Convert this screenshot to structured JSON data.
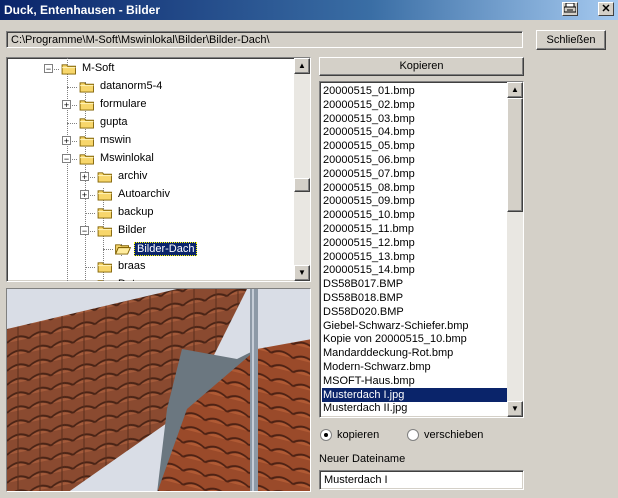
{
  "window": {
    "title": "Duck, Entenhausen - Bilder",
    "print_icon": "printer-icon",
    "close_glyph": "✕"
  },
  "path": "C:\\Programme\\M-Soft\\Mswinlokal\\Bilder\\Bilder-Dach\\",
  "buttons": {
    "close_label": "Schließen",
    "copy_label": "Kopieren"
  },
  "tree": {
    "items": [
      {
        "label": "M-Soft",
        "expander": "−"
      },
      {
        "label": "datanorm5-4",
        "expander": ""
      },
      {
        "label": "formulare",
        "expander": "+"
      },
      {
        "label": "gupta",
        "expander": ""
      },
      {
        "label": "mswin",
        "expander": "+"
      },
      {
        "label": "Mswinlokal",
        "expander": "−"
      },
      {
        "label": "archiv",
        "expander": "+"
      },
      {
        "label": "Autoarchiv",
        "expander": "+"
      },
      {
        "label": "backup",
        "expander": ""
      },
      {
        "label": "Bilder",
        "expander": "−"
      },
      {
        "label": "Bilder-Dach",
        "expander": ""
      },
      {
        "label": "braas",
        "expander": ""
      },
      {
        "label": "Data",
        "expander": ""
      }
    ]
  },
  "files": {
    "items": [
      "20000515_01.bmp",
      "20000515_02.bmp",
      "20000515_03.bmp",
      "20000515_04.bmp",
      "20000515_05.bmp",
      "20000515_06.bmp",
      "20000515_07.bmp",
      "20000515_08.bmp",
      "20000515_09.bmp",
      "20000515_10.bmp",
      "20000515_11.bmp",
      "20000515_12.bmp",
      "20000515_13.bmp",
      "20000515_14.bmp",
      "DS58B017.BMP",
      "DS58B018.BMP",
      "DS58D020.BMP",
      "Giebel-Schwarz-Schiefer.bmp",
      "Kopie von 20000515_10.bmp",
      "Mandarddeckung-Rot.bmp",
      "Modern-Schwarz.bmp",
      "MSOFT-Haus.bmp",
      "Musterdach I.jpg",
      "Musterdach II.jpg"
    ],
    "selected": "Musterdach I.jpg"
  },
  "options": {
    "copy": "kopieren",
    "move": "verschieben",
    "selected": "copy"
  },
  "new_name": {
    "label": "Neuer Dateiname",
    "value": "Musterdach I"
  },
  "colors": {
    "selection": "#0a246a",
    "face": "#d4d0c8",
    "folder": "#f7d66b"
  }
}
